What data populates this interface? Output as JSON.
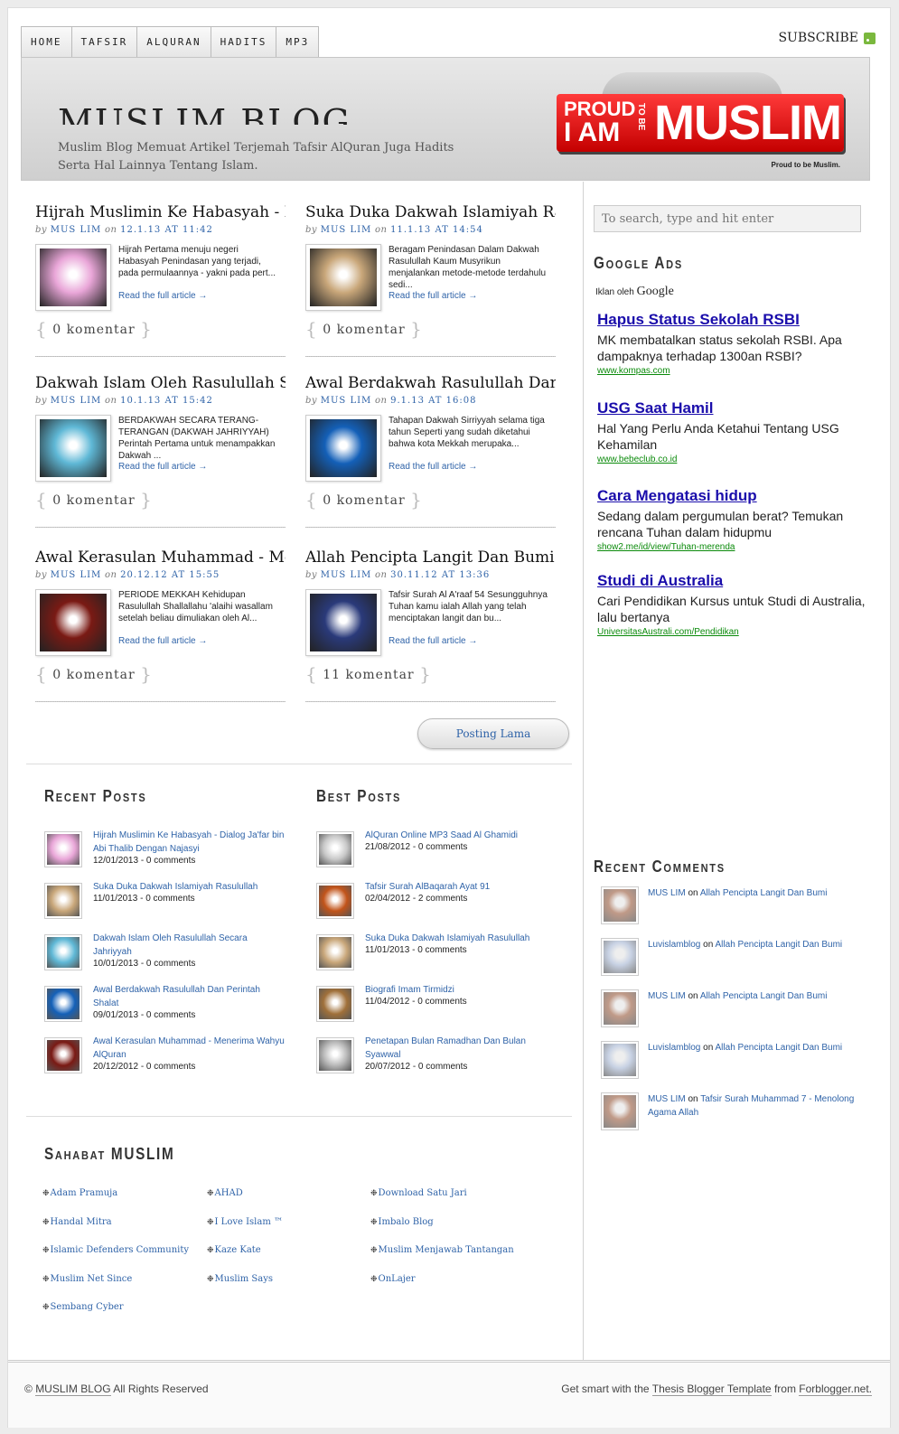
{
  "nav": {
    "items": [
      "HOME",
      "TAFSIR",
      "ALQURAN",
      "HADITS",
      "MP3"
    ],
    "subscribe": "SUBSCRIBE"
  },
  "header": {
    "title": "MUSLIM BLOG",
    "description": "Muslim Blog Memuat Artikel Terjemah Tafsir AlQuran Juga Hadits Serta Hal Lainnya Tentang Islam.",
    "logo": {
      "proud": "PROUD",
      "iam": "I AM",
      "tobe": "TO BE",
      "muslim": "MUSLIM",
      "tagline": "Proud to be Muslim."
    }
  },
  "posts": [
    {
      "title": "Hijrah Muslimin Ke Habasyah - Dialog Ja'far",
      "by": "by",
      "author": "MUS LIM",
      "on": "on",
      "date": "12.1.13 AT 11:42",
      "excerpt": "Hijrah Pertama menuju negeri Habasyah Penindasan yang terjadi, pada permulaannya - yakni pada pert...",
      "readmore": "Read the full article →",
      "comments_count": "0",
      "comments_label": "komentar",
      "thumb_color": "#e9a6d8"
    },
    {
      "title": "Suka Duka Dakwah Islamiyah Rasulullah",
      "by": "by",
      "author": "MUS LIM",
      "on": "on",
      "date": "11.1.13 AT 14:54",
      "excerpt": "Beragam Penindasan Dalam Dakwah Rasulullah Kaum Musyrikun menjalankan metode-metode terdahulu sedi...",
      "readmore": "Read the full article →",
      "comments_count": "0",
      "comments_label": "komentar",
      "thumb_color": "#c9a77a"
    },
    {
      "title": "Dakwah Islam Oleh Rasulullah Secara",
      "by": "by",
      "author": "MUS LIM",
      "on": "on",
      "date": "10.1.13 AT 15:42",
      "excerpt": "BERDAKWAH SECARA TERANG-TERANGAN (DAKWAH JAHRIYYAH) Perintah Pertama untuk menampakkan Dakwah ...",
      "readmore": "Read the full article →",
      "comments_count": "0",
      "comments_label": "komentar",
      "thumb_color": "#5fb8d6"
    },
    {
      "title": "Awal Berdakwah Rasulullah Dan Perintah",
      "by": "by",
      "author": "MUS LIM",
      "on": "on",
      "date": "9.1.13 AT 16:08",
      "excerpt": "Tahapan Dakwah Sirriyyah selama tiga tahun Seperti yang sudah diketahui bahwa kota Mekkah merupaka...",
      "readmore": "Read the full article →",
      "comments_count": "0",
      "comments_label": "komentar",
      "thumb_color": "#1460b8"
    },
    {
      "title": "Awal Kerasulan Muhammad - Menerima",
      "by": "by",
      "author": "MUS LIM",
      "on": "on",
      "date": "20.12.12 AT 15:55",
      "excerpt": "PERIODE MEKKAH Kehidupan Rasulullah Shallallahu 'alaihi wasallam setelah beliau dimuliakan oleh Al...",
      "readmore": "Read the full article →",
      "comments_count": "0",
      "comments_label": "komentar",
      "thumb_color": "#7a1a14"
    },
    {
      "title": "Allah Pencipta Langit Dan Bumi",
      "by": "by",
      "author": "MUS LIM",
      "on": "on",
      "date": "30.11.12 AT 13:36",
      "excerpt": "Tafsir Surah Al A'raaf 54 Sesungguhnya Tuhan kamu ialah Allah yang telah menciptakan langit dan bu...",
      "readmore": "Read the full article →",
      "comments_count": "11",
      "comments_label": "komentar",
      "thumb_color": "#2a3a7a"
    }
  ],
  "older_posts": "Posting Lama",
  "recent_posts": {
    "title": "Recent Posts",
    "items": [
      {
        "title": "Hijrah Muslimin Ke Habasyah - Dialog Ja'far bin Abi Thalib Dengan Najasyi",
        "meta": "12/01/2013 - 0 comments",
        "color": "#e9a6d8"
      },
      {
        "title": "Suka Duka Dakwah Islamiyah Rasulullah",
        "meta": "11/01/2013 - 0 comments",
        "color": "#c9a77a"
      },
      {
        "title": "Dakwah Islam Oleh Rasulullah Secara Jahriyyah",
        "meta": "10/01/2013 - 0 comments",
        "color": "#5fb8d6"
      },
      {
        "title": "Awal Berdakwah Rasulullah Dan Perintah Shalat",
        "meta": "09/01/2013 - 0 comments",
        "color": "#1460b8"
      },
      {
        "title": "Awal Kerasulan Muhammad - Menerima Wahyu AlQuran",
        "meta": "20/12/2012 - 0 comments",
        "color": "#7a1a14"
      }
    ]
  },
  "best_posts": {
    "title": "Best Posts",
    "items": [
      {
        "title": "AlQuran Online MP3 Saad Al Ghamidi",
        "meta": "21/08/2012 - 0 comments",
        "color": "#c8c8c8"
      },
      {
        "title": "Tafsir Surah AlBaqarah Ayat 91",
        "meta": "02/04/2012 - 2 comments",
        "color": "#c2541a"
      },
      {
        "title": "Suka Duka Dakwah Islamiyah Rasulullah",
        "meta": "11/01/2013 - 0 comments",
        "color": "#c9a77a"
      },
      {
        "title": "Biografi Imam Tirmidzi",
        "meta": "11/04/2012 - 0 comments",
        "color": "#a0703a"
      },
      {
        "title": "Penetapan Bulan Ramadhan Dan Bulan Syawwal",
        "meta": "20/07/2012 - 0 comments",
        "color": "#b8b8b8"
      }
    ]
  },
  "friends": {
    "title": "Sahabat MUSLIM",
    "bullet": "❉",
    "items": [
      "Adam Pramuja",
      "AHAD",
      "Download Satu Jari",
      "Handal Mitra",
      "I Love Islam ™",
      "Imbalo Blog",
      "Islamic Defenders Community",
      "Kaze Kate",
      "Muslim Menjawab Tantangan",
      "Muslim Net Since",
      "Muslim Says",
      "OnLajer",
      "Sembang Cyber"
    ]
  },
  "sidebar": {
    "search_placeholder": "To search, type and hit enter",
    "ads_title": "Google Ads",
    "ads_label": "Iklan oleh",
    "ads_brand": "Google",
    "ads": [
      {
        "title": "Hapus Status Sekolah RSBI",
        "text": "MK membatalkan status sekolah RSBI. Apa dampaknya terhadap 1300an RSBI?",
        "url": "www.kompas.com"
      },
      {
        "title": "USG Saat Hamil",
        "text": "Hal Yang Perlu Anda Ketahui Tentang USG Kehamilan",
        "url": "www.bebeclub.co.id"
      },
      {
        "title": "Cara Mengatasi hidup",
        "text": "Sedang dalam pergumulan berat? Temukan rencana Tuhan dalam hidupmu",
        "url": "show2.me/id/view/Tuhan-merenda"
      },
      {
        "title": "Studi di Australia",
        "text": "Cari Pendidikan Kursus untuk Studi di Australia, lalu bertanya",
        "url": "UniversitasAustrali.com/Pendidikan"
      }
    ],
    "recent_comments_title": "Recent Comments",
    "recent_comments": [
      {
        "author": "MUS LIM",
        "on": "on",
        "post": "Allah Pencipta Langit Dan Bumi",
        "avatar": "#c09a88"
      },
      {
        "author": "Luvislamblog",
        "on": "on",
        "post": "Allah Pencipta Langit Dan Bumi",
        "avatar": "#c8d2e4"
      },
      {
        "author": "MUS LIM",
        "on": "on",
        "post": "Allah Pencipta Langit Dan Bumi",
        "avatar": "#c09a88"
      },
      {
        "author": "Luvislamblog",
        "on": "on",
        "post": "Allah Pencipta Langit Dan Bumi",
        "avatar": "#c8d2e4"
      },
      {
        "author": "MUS LIM",
        "on": "on",
        "post": "Tafsir Surah Muhammad 7 - Menolong Agama Allah",
        "avatar": "#c09a88"
      }
    ]
  },
  "footer": {
    "copyright_symbol": "©",
    "copyright_link": "MUSLIM BLOG",
    "copyright_text": "All Rights Reserved",
    "credit_prefix": "Get smart with the",
    "credit_link": "Thesis Blogger Template",
    "credit_mid": "from",
    "credit_site": "Forblogger.net."
  }
}
